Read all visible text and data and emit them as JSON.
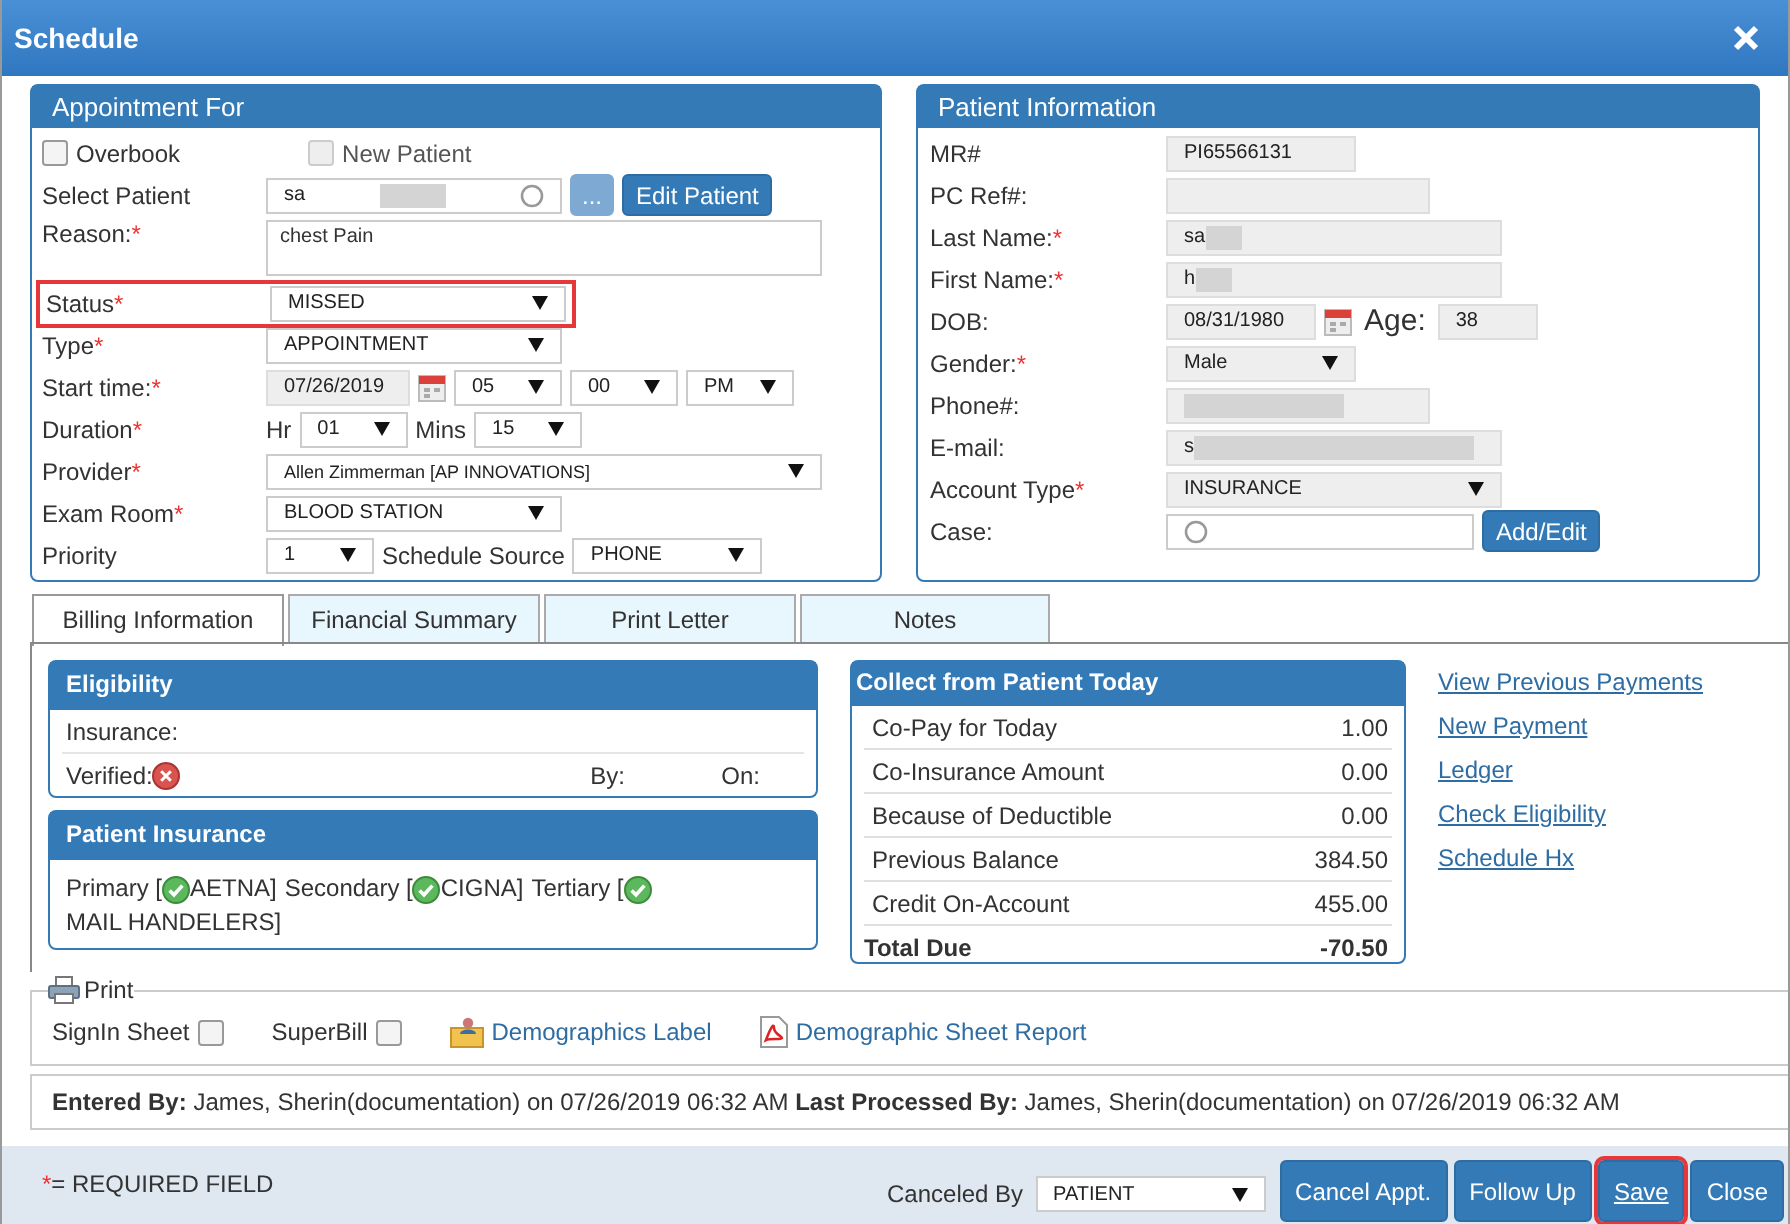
{
  "window": {
    "title": "Schedule"
  },
  "appointment": {
    "title": "Appointment For",
    "overbook": {
      "label": "Overbook",
      "checked": false
    },
    "new_patient": {
      "label": "New Patient",
      "checked": false,
      "disabled": true
    },
    "select_patient": {
      "label": "Select Patient",
      "value": "sa",
      "redacted": true,
      "browse": "...",
      "edit": "Edit Patient"
    },
    "reason": {
      "label": "Reason:",
      "mark": "*",
      "value": "chest Pain"
    },
    "status": {
      "label": "Status",
      "mark": "*",
      "value": "MISSED",
      "highlighted": true
    },
    "type": {
      "label": "Type",
      "mark": "*",
      "value": "APPOINTMENT"
    },
    "start_time": {
      "label": "Start time:",
      "mark": "*",
      "date": "07/26/2019",
      "hour": "05",
      "minute": "00",
      "ampm": "PM"
    },
    "duration": {
      "label": "Duration",
      "mark": "*",
      "hr_label": "Hr",
      "hr": "01",
      "mins_label": "Mins",
      "mins": "15"
    },
    "provider": {
      "label": "Provider",
      "mark": "*",
      "value": "Allen Zimmerman [AP INNOVATIONS]"
    },
    "exam_room": {
      "label": "Exam Room",
      "mark": "*",
      "value": "BLOOD STATION"
    },
    "priority": {
      "label": "Priority",
      "value": "1",
      "source_label": "Schedule Source",
      "source": "PHONE"
    }
  },
  "patient": {
    "title": "Patient Information",
    "mr": {
      "label": "MR#",
      "value": "PI65566131"
    },
    "pc_ref": {
      "label": "PC Ref#:"
    },
    "last_name": {
      "label": "Last Name:",
      "mark": "*",
      "value": "sa",
      "redacted": true
    },
    "first_name": {
      "label": "First Name:",
      "mark": "*",
      "value": "h",
      "redacted": true
    },
    "dob": {
      "label": "DOB:",
      "value": "08/31/1980",
      "age_label": "Age:",
      "age": "38"
    },
    "gender": {
      "label": "Gender:",
      "mark": "*",
      "value": "Male"
    },
    "phone": {
      "label": "Phone#:",
      "redacted": true
    },
    "email": {
      "label": "E-mail:",
      "value": "s",
      "redacted": true
    },
    "account_type": {
      "label": "Account Type",
      "mark": "*",
      "value": "INSURANCE"
    },
    "case": {
      "label": "Case:",
      "button": "Add/Edit"
    }
  },
  "tabs": [
    {
      "label": "Billing Information",
      "selected": true
    },
    {
      "label": "Financial Summary",
      "selected": false
    },
    {
      "label": "Print Letter",
      "selected": false
    },
    {
      "label": "Notes",
      "selected": false
    }
  ],
  "eligibility": {
    "title": "Eligibility",
    "insurance_label": "Insurance:",
    "verified_label": "Verified:",
    "verified": false,
    "by_label": "By:",
    "on_label": "On:"
  },
  "patient_insurance": {
    "title": "Patient Insurance",
    "items": [
      {
        "before": "Primary [",
        "name": "AETNA]",
        "verified": true
      },
      {
        "before": "Secondary [",
        "name": "CIGNA]",
        "verified": true
      },
      {
        "before": "Tertiary [",
        "name": "MAIL HANDELERS]",
        "verified": true
      }
    ]
  },
  "collect": {
    "title": "Collect from Patient Today",
    "rows": [
      {
        "label": "Co-Pay for Today",
        "amount": "1.00",
        "total": false
      },
      {
        "label": "Co-Insurance Amount",
        "amount": "0.00",
        "total": false
      },
      {
        "label": "Because of Deductible",
        "amount": "0.00",
        "total": false
      },
      {
        "label": "Previous Balance",
        "amount": "384.50",
        "total": false
      },
      {
        "label": "Credit On-Account",
        "amount": "455.00",
        "total": false
      },
      {
        "label": "Total Due",
        "amount": "-70.50",
        "total": true
      }
    ]
  },
  "links": [
    "View Previous Payments",
    "New Payment",
    "Ledger",
    "Check Eligibility",
    "Schedule Hx"
  ],
  "print": {
    "legend": "Print",
    "signin": {
      "label": "SignIn Sheet",
      "checked": false
    },
    "superbill": {
      "label": "SuperBill",
      "checked": false
    },
    "demographics_label": "Demographics Label",
    "sheet_report": "Demographic Sheet Report"
  },
  "audit": "**Entered By:** James, Sherin(documentation) on 07/26/2019 06:32 AM  **Last Processed By:** James, Sherin(documentation) on 07/26/2019 06:32 AM",
  "footer": {
    "mark": "*",
    "required_text": "= REQUIRED FIELD",
    "canceled_by_label": "Canceled By",
    "canceled_by": "PATIENT",
    "buttons": [
      {
        "label": "Cancel Appt.",
        "highlighted": false
      },
      {
        "label": "Follow Up",
        "highlighted": false
      },
      {
        "label": "Save",
        "highlighted": true
      },
      {
        "label": "Close",
        "highlighted": false
      }
    ]
  }
}
